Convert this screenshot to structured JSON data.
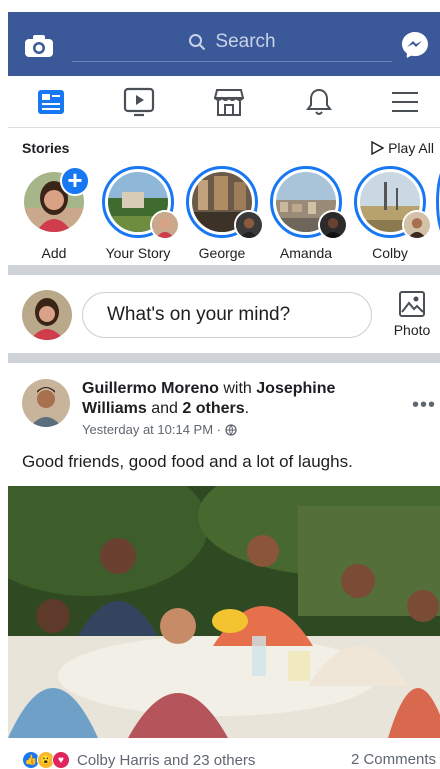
{
  "header": {
    "search_placeholder": "Search",
    "icons": {
      "camera": "camera-icon",
      "messenger": "messenger-icon"
    },
    "brand_color": "#3b5998"
  },
  "nav": {
    "tabs": [
      {
        "name": "news-feed",
        "icon": "news-feed-icon",
        "active": true
      },
      {
        "name": "watch",
        "icon": "watch-icon",
        "active": false
      },
      {
        "name": "marketplace",
        "icon": "marketplace-icon",
        "active": false
      },
      {
        "name": "notifications",
        "icon": "bell-icon",
        "active": false
      },
      {
        "name": "menu",
        "icon": "menu-icon",
        "active": false
      }
    ],
    "active_color": "#1877f2"
  },
  "stories": {
    "heading": "Stories",
    "play_all": "Play All",
    "items": [
      {
        "label": "Add"
      },
      {
        "label": "Your Story"
      },
      {
        "label": "George"
      },
      {
        "label": "Amanda"
      },
      {
        "label": "Colby"
      }
    ]
  },
  "composer": {
    "placeholder": "What's on your mind?",
    "photo_label": "Photo"
  },
  "post": {
    "author": "Guillermo Moreno",
    "with_text": "with",
    "tagged": "Josephine Williams",
    "and_text": "and",
    "others": "2 others",
    "time": "Yesterday at 10:14 PM ·",
    "text": "Good friends, good food and a lot of laughs.",
    "reactions_names": "Colby Harris and 23 others",
    "comments": "2 Comments",
    "reaction_colors": {
      "like": "#1877f2",
      "wow": "#f7b928",
      "love": "#e0245e"
    }
  }
}
